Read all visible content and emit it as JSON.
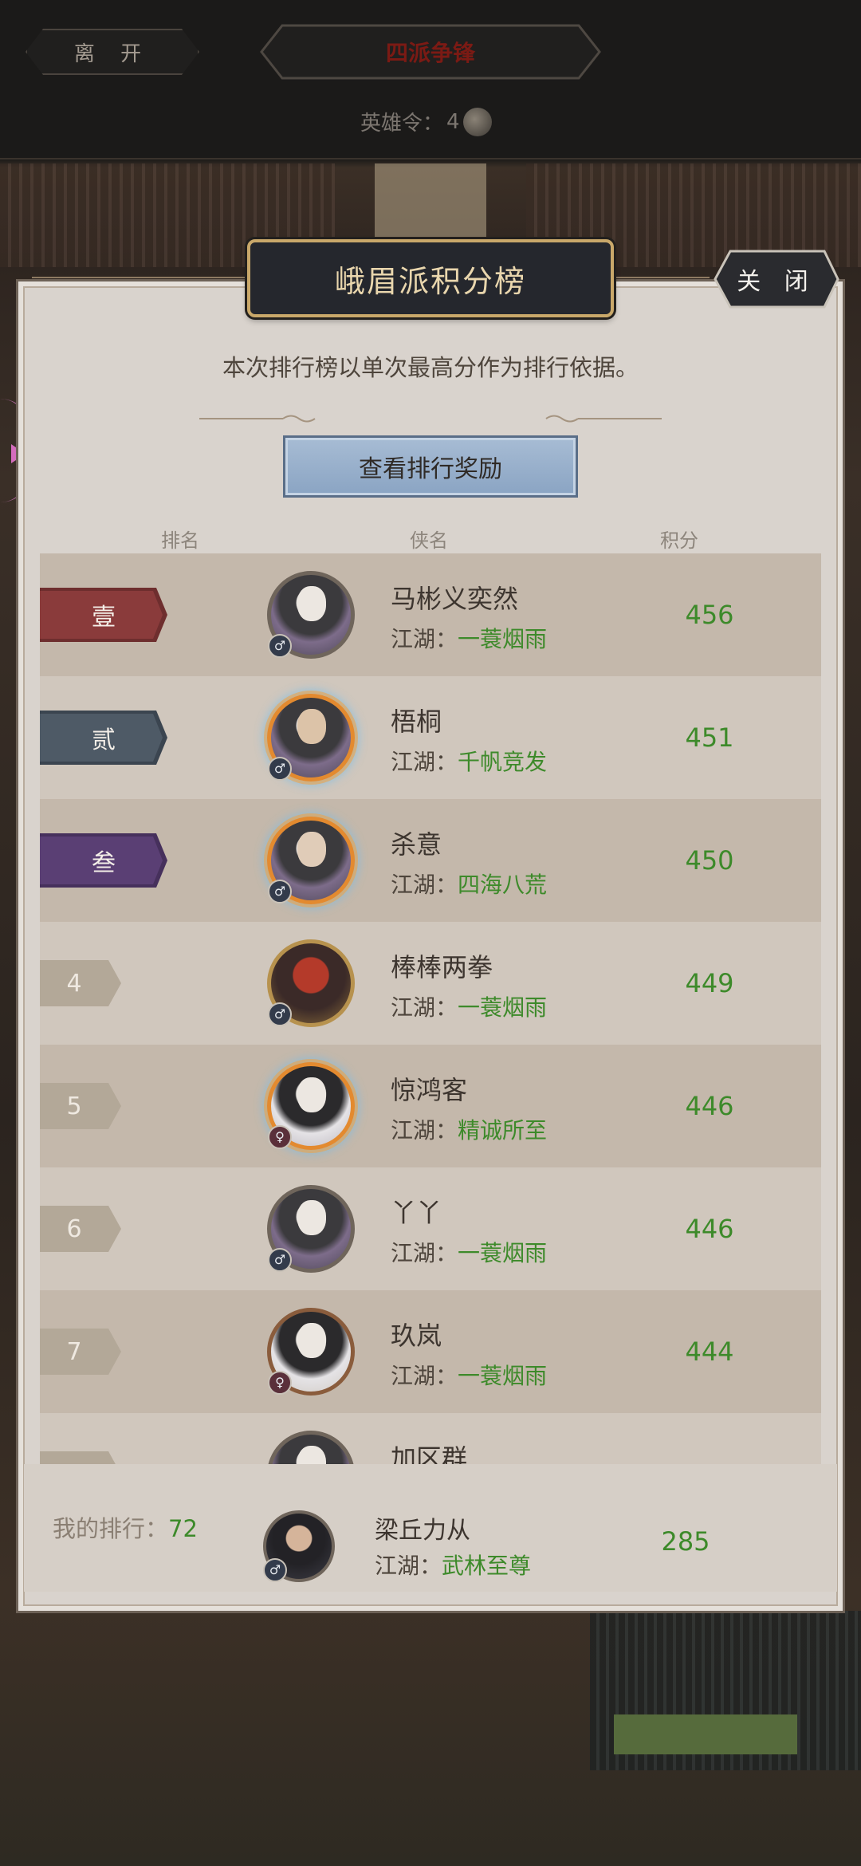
{
  "topbar": {
    "leave_label": "离 开",
    "event_title": "四派争锋",
    "hero_token_label": "英雄令：",
    "hero_token_count": "4"
  },
  "panel": {
    "title": "峨眉派积分榜",
    "close_label": "关 闭",
    "rule_text": "本次排行榜以单次最高分作为排行依据。",
    "reward_button": "查看排行奖励",
    "columns": {
      "rank": "排名",
      "name": "侠名",
      "score": "积分"
    }
  },
  "guild_prefix": "江湖：",
  "rows": [
    {
      "rank": "壹",
      "name": "马彬义奕然",
      "guild": "一蓑烟雨",
      "score": "456",
      "gender": "♂"
    },
    {
      "rank": "贰",
      "name": "梧桐",
      "guild": "千帆竞发",
      "score": "451",
      "gender": "♂"
    },
    {
      "rank": "叁",
      "name": "杀意",
      "guild": "四海八荒",
      "score": "450",
      "gender": "♂"
    },
    {
      "rank": "4",
      "name": "棒棒两拳",
      "guild": "一蓑烟雨",
      "score": "449",
      "gender": "♂"
    },
    {
      "rank": "5",
      "name": "惊鸿客",
      "guild": "精诚所至",
      "score": "446",
      "gender": "♀"
    },
    {
      "rank": "6",
      "name": "丫丫",
      "guild": "一蓑烟雨",
      "score": "446",
      "gender": "♂"
    },
    {
      "rank": "7",
      "name": "玖岚",
      "guild": "一蓑烟雨",
      "score": "444",
      "gender": "♀"
    },
    {
      "rank": "",
      "name": "加区群",
      "guild": "",
      "score": "",
      "gender": ""
    }
  ],
  "my_rank": {
    "label": "我的排行：",
    "value": "72",
    "name": "梁丘力从",
    "guild": "武林至尊",
    "score": "285",
    "gender": "♂"
  },
  "colors": {
    "rank1": "#8a3b3b",
    "rank2": "#4e5a66",
    "rank3": "#5a3f74",
    "score_green": "#3d8a2a",
    "header_gold": "#c9a86a"
  }
}
